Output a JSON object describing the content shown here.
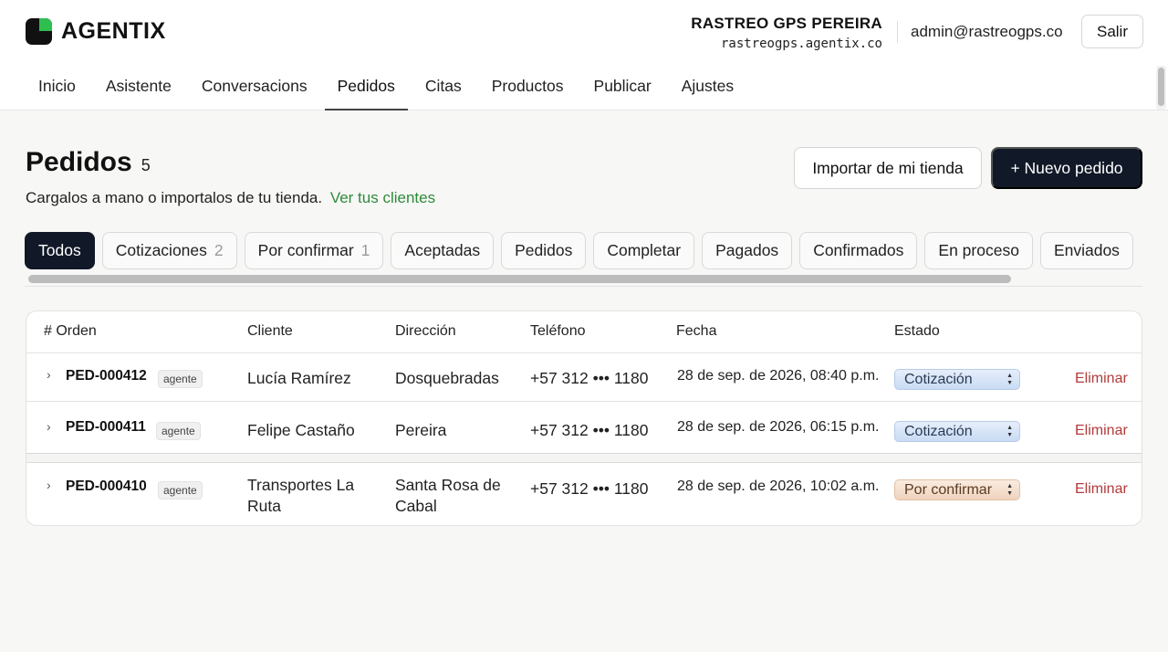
{
  "app": {
    "brand": "AGENTIX",
    "org_name": "RASTREO GPS PEREIRA",
    "org_domain": "rastreogps.agentix.co",
    "user_email": "admin@rastreogps.co",
    "logout_label": "Salir"
  },
  "nav": {
    "items": [
      "Inicio",
      "Asistente",
      "Conversacions",
      "Pedidos",
      "Citas",
      "Productos",
      "Publicar",
      "Ajustes"
    ],
    "active": "Pedidos"
  },
  "page": {
    "title": "Pedidos",
    "count": "5",
    "subtitle": "Cargalos a mano o importalos de tu tienda.",
    "subtitle_link": "Ver tus clientes",
    "import_label": "Importar de mi tienda",
    "new_label": "+ Nuevo pedido"
  },
  "filters": [
    {
      "label": "Todos",
      "count": ""
    },
    {
      "label": "Cotizaciones",
      "count": "2"
    },
    {
      "label": "Por confirmar",
      "count": "1"
    },
    {
      "label": "Aceptadas",
      "count": ""
    },
    {
      "label": "Pedidos",
      "count": ""
    },
    {
      "label": "Completar",
      "count": ""
    },
    {
      "label": "Pagados",
      "count": ""
    },
    {
      "label": "Confirmados",
      "count": ""
    },
    {
      "label": "En proceso",
      "count": ""
    },
    {
      "label": "Enviados",
      "count": ""
    }
  ],
  "table": {
    "headers": {
      "order": "# Orden",
      "client": "Cliente",
      "address": "Dirección",
      "phone": "Teléfono",
      "date": "Fecha",
      "status": "Estado"
    },
    "rows": [
      {
        "order": "PED-000412",
        "tag": "agente",
        "client": "Lucía Ramírez",
        "address": "Dosquebradas",
        "phone": "+57 312 ••• 1180",
        "date": "28 de sep. de 2026, 08:40 p.m.",
        "status": "Cotización",
        "delete": "Eliminar"
      },
      {
        "order": "PED-000411",
        "tag": "agente",
        "client": "Felipe Castaño",
        "address": "Pereira",
        "phone": "+57 312 ••• 1180",
        "date": "28 de sep. de 2026, 06:15 p.m.",
        "status": "Cotización",
        "delete": "Eliminar"
      },
      {
        "order": "PED-000410",
        "tag": "agente",
        "client_line1": "Transportes La",
        "client_line2": "Ruta",
        "address_line1": "Santa Rosa de",
        "address_line2": "Cabal",
        "phone": "+57 312 ••• 1180",
        "date": "28 de sep. de 2026, 10:02 a.m.",
        "status": "Por confirmar",
        "delete": "Eliminar"
      }
    ]
  },
  "colors": {
    "accent_dark": "#111827",
    "brand_green": "#2fbf4f",
    "link_green": "#2e8b3a",
    "delete_red": "#b23a3a"
  },
  "icons": {
    "logo": "logo-mark-icon",
    "row_expand": "chevron-right-icon",
    "select_caret": "select-caret-icon"
  }
}
